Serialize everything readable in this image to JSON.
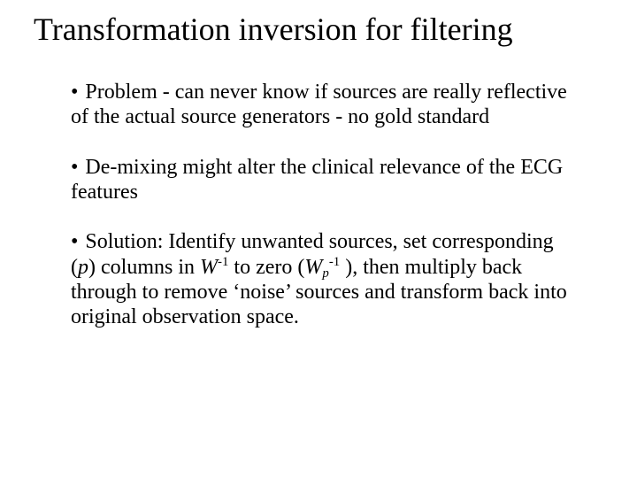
{
  "title": "Transformation inversion for filtering",
  "bullets": {
    "b1": {
      "dot": "•",
      "text": " Problem - can never know if sources are really reflective of the actual source generators - no gold standard"
    },
    "b2": {
      "dot": "•",
      "text": " De-mixing might alter the clinical relevance of the ECG features"
    },
    "b3": {
      "dot": "•",
      "pre": " Solution: Identify unwanted sources, set corresponding (",
      "p1": "p",
      "mid1": ") columns in ",
      "W1": "W",
      "sup1": "-1",
      "mid2": "  to zero (",
      "W2": "W",
      "sub_p": "p",
      "sup2": "-1",
      "mid3": " ), then multiply back through to remove ‘noise’ sources and  transform back into original observation space."
    }
  }
}
